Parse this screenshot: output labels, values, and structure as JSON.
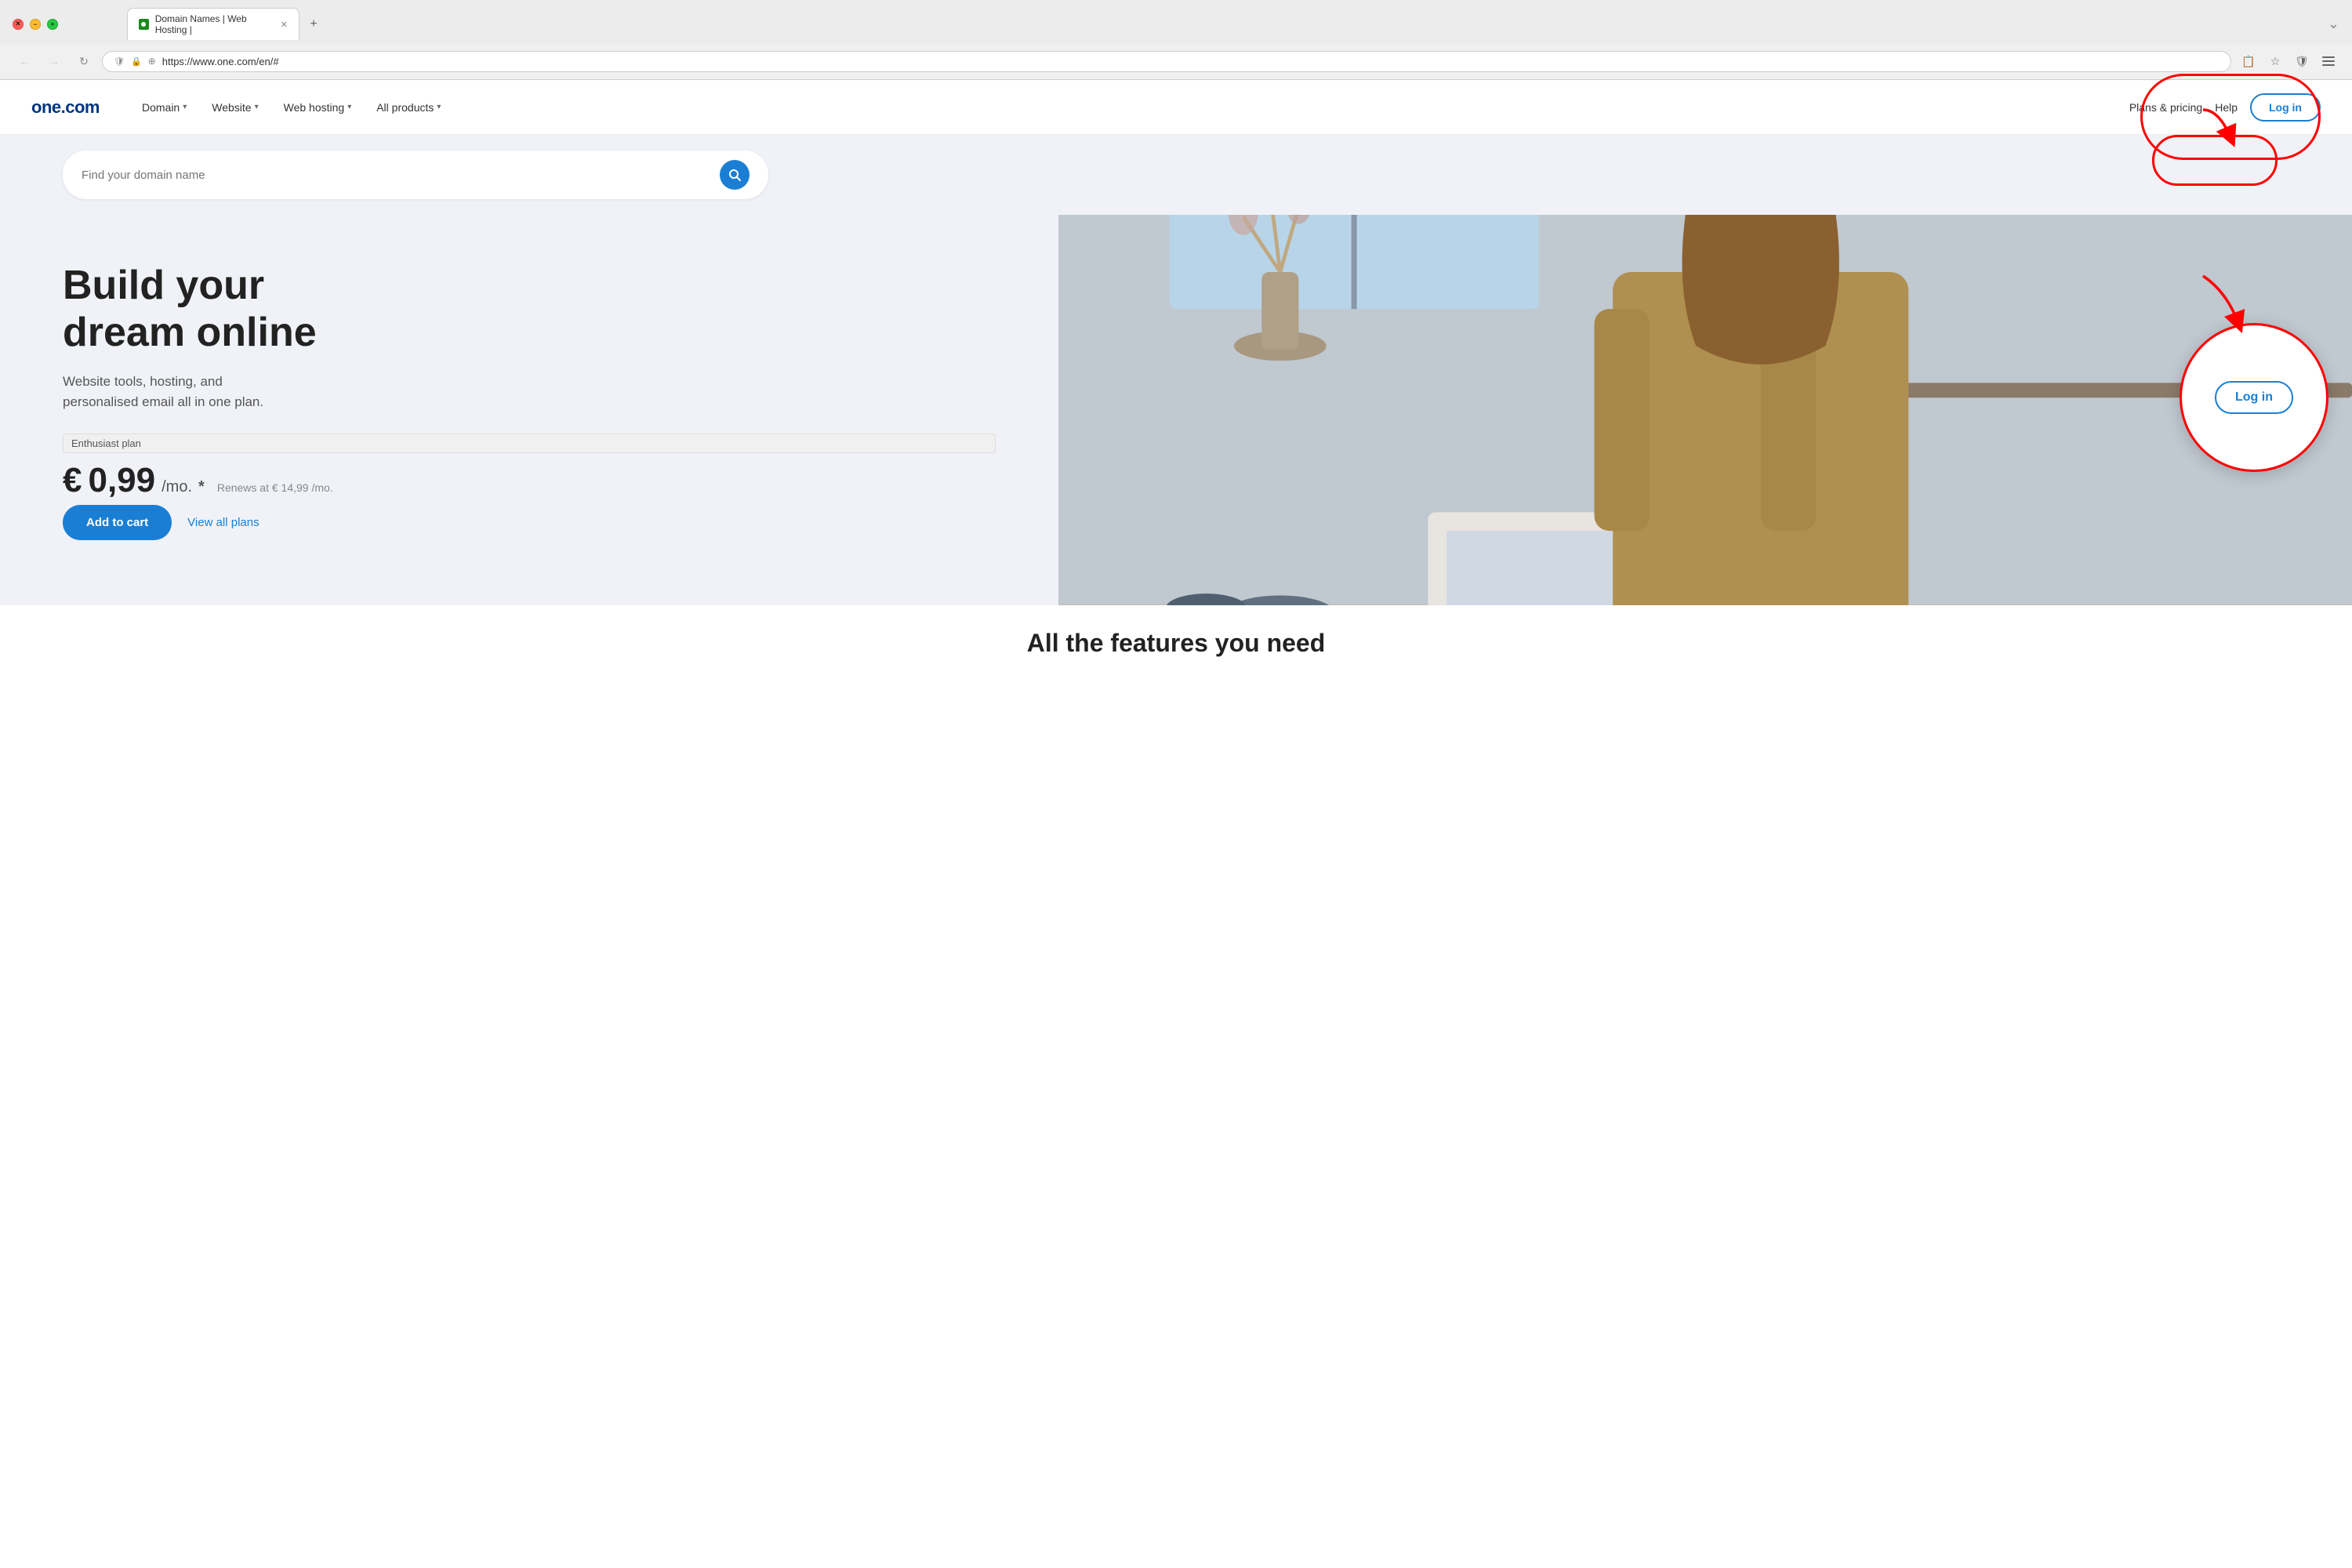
{
  "browser": {
    "tab_title": "Domain Names | Web Hosting |",
    "tab_favicon_alt": "one.com favicon",
    "address": "https://www.one.com/en/#",
    "nav_back_label": "←",
    "nav_forward_label": "→",
    "nav_refresh_label": "↻",
    "new_tab_label": "+"
  },
  "navbar": {
    "logo": "one.com",
    "menu_items": [
      {
        "label": "Domain",
        "has_dropdown": true
      },
      {
        "label": "Website",
        "has_dropdown": true
      },
      {
        "label": "Web hosting",
        "has_dropdown": true
      },
      {
        "label": "All products",
        "has_dropdown": true
      }
    ],
    "plans_label": "Plans & pricing",
    "help_label": "Help",
    "login_label": "Log in"
  },
  "hero": {
    "search_placeholder": "Find your domain name",
    "title_line1": "Build your",
    "title_line2": "dream online",
    "subtitle": "Website tools, hosting, and\npersonalised email all in one plan.",
    "plan_badge": "Enthusiast plan",
    "price_symbol": "€",
    "price": "0,99",
    "price_unit": "/mo.",
    "price_asterisk": "*",
    "renews": "Renews at € 14,99 /mo.",
    "add_to_cart": "Add to cart",
    "view_all_plans": "View all plans"
  },
  "annotation": {
    "circle_login_label": "Log in",
    "arrow_1": "↘",
    "arrow_2": "↘"
  },
  "bottom": {
    "hint_text": "All the features you need"
  }
}
